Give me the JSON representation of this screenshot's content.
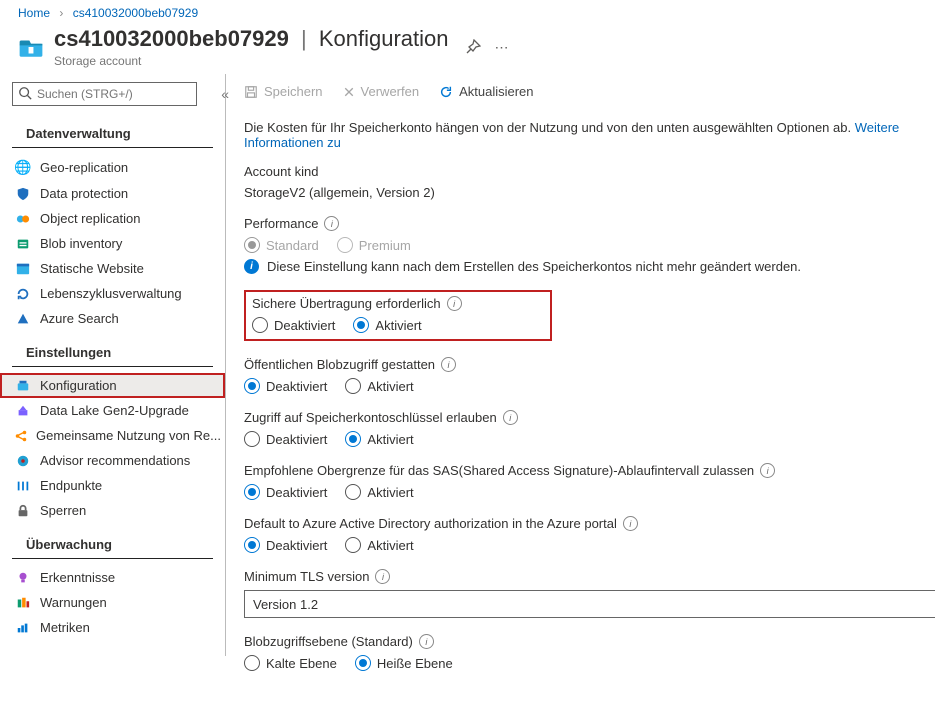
{
  "breadcrumb": {
    "home": "Home",
    "resource": "cs410032000beb07929"
  },
  "header": {
    "title": "cs410032000beb07929",
    "page": "Konfiguration",
    "subtitle": "Storage account"
  },
  "search": {
    "placeholder": "Suchen (STRG+/)"
  },
  "groups": {
    "data": "Datenverwaltung",
    "settings": "Einstellungen",
    "monitoring": "Überwachung"
  },
  "nav": {
    "geo": "Geo-replication",
    "protection": "Data protection",
    "objrep": "Object replication",
    "blobinv": "Blob inventory",
    "staticweb": "Statische Website",
    "lifecycle": "Lebenszyklusverwaltung",
    "azsearch": "Azure Search",
    "config": "Konfiguration",
    "gen2": "Data Lake Gen2-Upgrade",
    "sharing": "Gemeinsame Nutzung von Re...",
    "advisor": "Advisor recommendations",
    "endpoints": "Endpunkte",
    "locks": "Sperren",
    "insights": "Erkenntnisse",
    "alerts": "Warnungen",
    "metrics": "Metriken"
  },
  "toolbar": {
    "save": "Speichern",
    "discard": "Verwerfen",
    "refresh": "Aktualisieren"
  },
  "intro": {
    "text": "Die Kosten für Ihr Speicherkonto hängen von der Nutzung und von den unten ausgewählten Optionen ab.",
    "link": "Weitere Informationen zu"
  },
  "accountKind": {
    "label": "Account kind",
    "value": "StorageV2 (allgemein, Version 2)"
  },
  "performance": {
    "label": "Performance",
    "standard": "Standard",
    "premium": "Premium",
    "note": "Diese Einstellung kann nach dem Erstellen des Speicherkontos nicht mehr geändert werden."
  },
  "secureTransfer": {
    "label": "Sichere Übertragung erforderlich",
    "off": "Deaktiviert",
    "on": "Aktiviert"
  },
  "publicBlob": {
    "label": "Öffentlichen Blobzugriff gestatten",
    "off": "Deaktiviert",
    "on": "Aktiviert"
  },
  "keyAccess": {
    "label": "Zugriff auf Speicherkontoschlüssel erlauben",
    "off": "Deaktiviert",
    "on": "Aktiviert"
  },
  "sasLimit": {
    "label": "Empfohlene Obergrenze für das SAS(Shared Access Signature)-Ablaufintervall zulassen",
    "off": "Deaktiviert",
    "on": "Aktiviert"
  },
  "aadDefault": {
    "label": "Default to Azure Active Directory authorization in the Azure portal",
    "off": "Deaktiviert",
    "on": "Aktiviert"
  },
  "tls": {
    "label": "Minimum TLS version",
    "value": "Version 1.2"
  },
  "accessTier": {
    "label": "Blobzugriffsebene (Standard)",
    "cool": "Kalte Ebene",
    "hot": "Heiße Ebene"
  }
}
